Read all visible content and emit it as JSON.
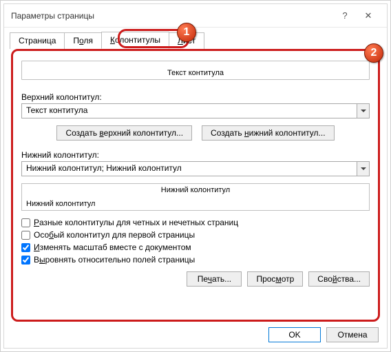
{
  "title": "Параметры страницы",
  "titlebar": {
    "help": "?",
    "close": "✕"
  },
  "tabs": {
    "page": "Страница",
    "fields_pre": "П",
    "fields_u": "о",
    "fields_post": "ля",
    "headers_pre": "",
    "headers_u": "К",
    "headers_post": "олонтитулы",
    "sheet_pre": "",
    "sheet_u": "Л",
    "sheet_post": "ист"
  },
  "header_preview": "Текст контитула",
  "upper": {
    "label_pre": "Вер",
    "label_u": "х",
    "label_post": "ний колонтитул:",
    "value": "Текст контитула"
  },
  "lower": {
    "label_pre": "Н",
    "label_u": "и",
    "label_post": "жний колонтитул:",
    "value": "Нижний колонтитул; Нижний колонтитул"
  },
  "create_upper_pre": "Создать ",
  "create_upper_u": "в",
  "create_upper_post": "ерхний колонтитул...",
  "create_lower_pre": "Создать ",
  "create_lower_u": "н",
  "create_lower_post": "ижний колонтитул...",
  "lower_preview": {
    "center": "Нижний колонтитул",
    "left": "Нижний колонтитул"
  },
  "checks": {
    "c1_pre": "",
    "c1_u": "Р",
    "c1_post": "азные колонтитулы для четных и нечетных страниц",
    "c2_pre": "Осо",
    "c2_u": "б",
    "c2_post": "ый колонтитул для первой страницы",
    "c3_pre": "",
    "c3_u": "И",
    "c3_post": "зменять масштаб вместе с документом",
    "c4_pre": "В",
    "c4_u": "ы",
    "c4_post": "ровнять относительно полей страницы"
  },
  "footer": {
    "print_pre": "Пе",
    "print_u": "ч",
    "print_post": "ать...",
    "preview_pre": "Прос",
    "preview_u": "м",
    "preview_post": "отр",
    "props_pre": "Сво",
    "props_u": "й",
    "props_post": "ства..."
  },
  "dlg": {
    "ok": "OK",
    "cancel": "Отмена"
  },
  "badges": {
    "b1": "1",
    "b2": "2"
  }
}
